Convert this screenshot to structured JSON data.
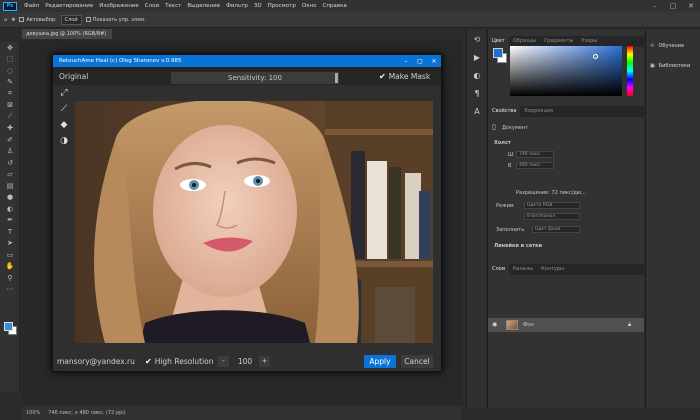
{
  "menubar": {
    "items": [
      "Файл",
      "Редактирование",
      "Изображение",
      "Слои",
      "Текст",
      "Выделение",
      "Фильтр",
      "3D",
      "Просмотр",
      "Окно",
      "Справка"
    ]
  },
  "options": {
    "autoselect": "Автовыбор:",
    "layer": "Слой",
    "transform": "Показать упр. элем."
  },
  "document": {
    "tab_label": "девушка.jpg @ 100% (RGB/8#)"
  },
  "plugin": {
    "title": "RetouchAme Heal (c) Oleg Sharonov v.0.985",
    "original_label": "Original",
    "sensitivity_label": "Sensitivity: 100",
    "make_mask_label": "Make Mask",
    "email": "mansory@yandex.ru",
    "high_res_label": "High Resolution",
    "resolution_value": "100",
    "minus": "-",
    "plus": "+",
    "apply_label": "Apply",
    "cancel_label": "Cancel"
  },
  "status": {
    "zoom": "100%",
    "info": "746 пикс. x 480 пикс. (72 ppi)"
  },
  "panels": {
    "color_tabs": [
      "Цвет",
      "Образцы",
      "Градиенты",
      "Узоры"
    ],
    "properties_tabs": [
      "Свойства",
      "Коррекция"
    ],
    "doc_label": "Документ",
    "canvas_section": "Холст",
    "width_label": "Ш",
    "width_value": "746 пикс.",
    "height_label": "В",
    "height_value": "480 пикс.",
    "resolution_text": "Разрешение: 72 пикс/дю...",
    "mode_label": "Режим",
    "mode_value": "Цвета RGB",
    "bits_value": "8 бит/канал",
    "fill_label": "Заполнить",
    "fill_value": "Цвет фона",
    "guides_section": "Линейки и сетки",
    "layers_tabs": [
      "Слои",
      "Каналы",
      "Контуры"
    ],
    "layer_name": "Фон"
  },
  "far_right": {
    "learn": "Обучение",
    "libraries": "Библиотеки"
  },
  "colors": {
    "accent": "#0a74d6",
    "foreground": "#1d6fd6",
    "background": "#ffffff"
  }
}
